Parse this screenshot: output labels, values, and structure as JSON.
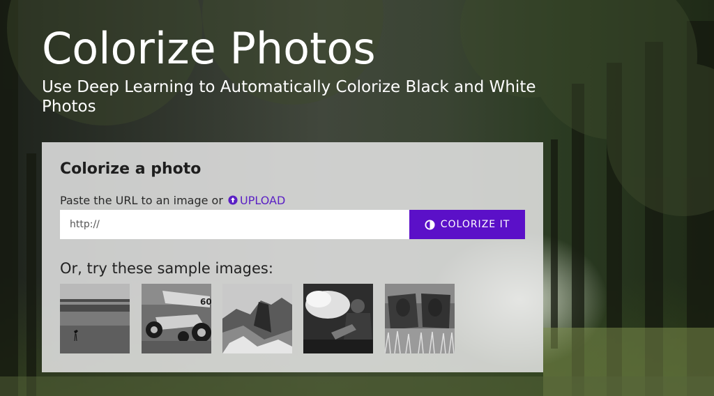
{
  "hero": {
    "title": "Colorize Photos",
    "subtitle": "Use Deep Learning to Automatically Colorize Black and White Photos"
  },
  "card": {
    "title": "Colorize a photo",
    "paste_prompt": "Paste the URL to an image or",
    "upload_label": "UPLOAD",
    "upload_icon": "upload-circle-icon",
    "url_input": {
      "placeholder": "http://",
      "value": ""
    },
    "colorize_button": {
      "label": "COLORIZE IT",
      "icon": "half-circle-contrast-icon"
    },
    "samples_heading": "Or, try these sample images:",
    "samples": [
      {
        "subject": "bird-on-beach"
      },
      {
        "subject": "sprint-car"
      },
      {
        "subject": "half-dome-mountain"
      },
      {
        "subject": "fire-breather"
      },
      {
        "subject": "cows-in-field"
      }
    ]
  },
  "colors": {
    "accent": "#5b10c8",
    "link": "#5a1fc4",
    "card_background": "#e8e8e8",
    "text_white": "#ffffff"
  }
}
